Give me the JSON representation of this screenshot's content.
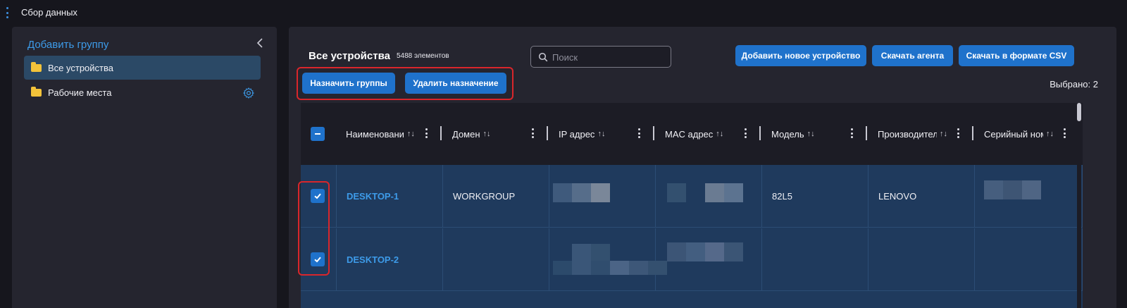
{
  "app": {
    "title": "Сбор данных"
  },
  "sidebar": {
    "add_group_label": "Добавить группу",
    "items": [
      {
        "label": "Все устройства",
        "active": true
      },
      {
        "label": "Рабочие места",
        "active": false
      }
    ]
  },
  "main": {
    "heading": "Все устройства",
    "count_label": "5488 элементов",
    "search": {
      "placeholder": "Поиск",
      "value": ""
    },
    "buttons": {
      "add_device": "Добавить новое устройство",
      "download_agent": "Скачать агента",
      "download_csv": "Скачать в формате CSV",
      "assign_groups": "Назначить группы",
      "remove_assignment": "Удалить назначение"
    },
    "selected_label": "Выбрано: 2"
  },
  "table": {
    "columns": [
      "Наименовани",
      "Домен",
      "IP адрес",
      "MAC адрес",
      "Модель",
      "Производител",
      "Серийный ном"
    ],
    "sort_glyph": "↑↓",
    "rows": [
      {
        "checked": true,
        "name": "DESKTOP-1",
        "domain": "WORKGROUP",
        "ip": "",
        "mac": "",
        "model": "82L5",
        "vendor": "LENOVO",
        "serial": ""
      },
      {
        "checked": true,
        "name": "DESKTOP-2",
        "domain": "",
        "ip": "",
        "mac": "",
        "model": "",
        "vendor": "",
        "serial": ""
      }
    ]
  },
  "colors": {
    "accent": "#1f72cb",
    "link": "#3d9be9",
    "highlight": "#d9262b",
    "row_bg": "#1f3a5d",
    "panel_bg": "#25252f"
  }
}
